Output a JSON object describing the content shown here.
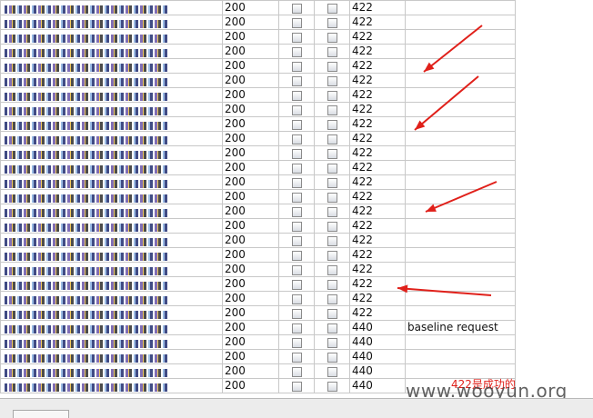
{
  "rows": [
    {
      "status": "200",
      "length": "422",
      "comment": ""
    },
    {
      "status": "200",
      "length": "422",
      "comment": ""
    },
    {
      "status": "200",
      "length": "422",
      "comment": ""
    },
    {
      "status": "200",
      "length": "422",
      "comment": ""
    },
    {
      "status": "200",
      "length": "422",
      "comment": ""
    },
    {
      "status": "200",
      "length": "422",
      "comment": ""
    },
    {
      "status": "200",
      "length": "422",
      "comment": ""
    },
    {
      "status": "200",
      "length": "422",
      "comment": ""
    },
    {
      "status": "200",
      "length": "422",
      "comment": ""
    },
    {
      "status": "200",
      "length": "422",
      "comment": ""
    },
    {
      "status": "200",
      "length": "422",
      "comment": ""
    },
    {
      "status": "200",
      "length": "422",
      "comment": ""
    },
    {
      "status": "200",
      "length": "422",
      "comment": ""
    },
    {
      "status": "200",
      "length": "422",
      "comment": ""
    },
    {
      "status": "200",
      "length": "422",
      "comment": ""
    },
    {
      "status": "200",
      "length": "422",
      "comment": ""
    },
    {
      "status": "200",
      "length": "422",
      "comment": ""
    },
    {
      "status": "200",
      "length": "422",
      "comment": ""
    },
    {
      "status": "200",
      "length": "422",
      "comment": ""
    },
    {
      "status": "200",
      "length": "422",
      "comment": ""
    },
    {
      "status": "200",
      "length": "422",
      "comment": ""
    },
    {
      "status": "200",
      "length": "422",
      "comment": ""
    },
    {
      "status": "200",
      "length": "440",
      "comment": "baseline request"
    },
    {
      "status": "200",
      "length": "440",
      "comment": ""
    },
    {
      "status": "200",
      "length": "440",
      "comment": ""
    },
    {
      "status": "200",
      "length": "440",
      "comment": ""
    },
    {
      "status": "200",
      "length": "440",
      "comment": ""
    }
  ],
  "annotation": {
    "note": "422是成功的",
    "watermark": "www.wooyun.org",
    "arrow_color": "#e0201a"
  }
}
